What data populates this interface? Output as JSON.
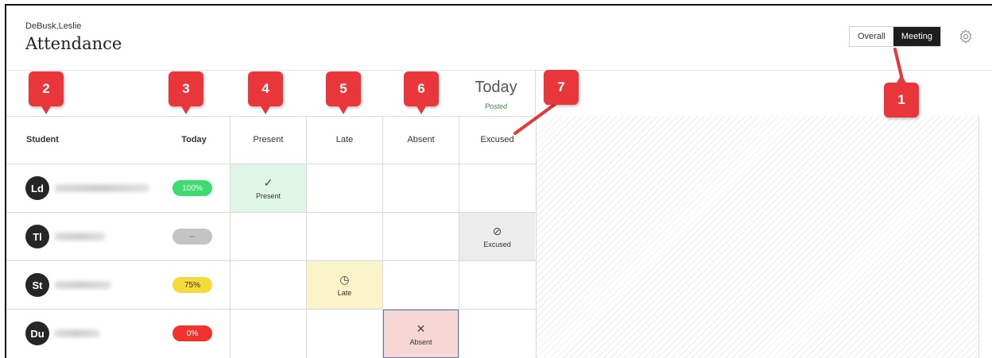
{
  "header": {
    "course_name": "DeBusk,Leslie",
    "title": "Attendance",
    "view_toggle": {
      "overall_label": "Overall",
      "meeting_label": "Meeting",
      "selected": "Meeting"
    },
    "settings_icon": "gear-icon"
  },
  "meeting": {
    "today_label": "Today",
    "status": "Posted"
  },
  "columns": {
    "student": "Student",
    "today": "Today",
    "present": "Present",
    "late": "Late",
    "absent": "Absent",
    "excused": "Excused"
  },
  "rows": [
    {
      "initials": "Ld",
      "today_pct": "100%",
      "status": "Present",
      "status_label": "Present",
      "status_icon": "check-icon"
    },
    {
      "initials": "Tl",
      "today_pct": "--",
      "status": "Excused",
      "status_label": "Excused",
      "status_icon": "circle-slash-icon"
    },
    {
      "initials": "St",
      "today_pct": "75%",
      "status": "Late",
      "status_label": "Late",
      "status_icon": "clock-icon"
    },
    {
      "initials": "Du",
      "today_pct": "0%",
      "status": "Absent",
      "status_label": "Absent",
      "status_icon": "x-icon"
    }
  ],
  "callouts": [
    "1",
    "2",
    "3",
    "4",
    "5",
    "6",
    "7"
  ],
  "colors": {
    "pill_100": "#3ddc6e",
    "pill_none": "#c4c4c4",
    "pill_75": "#f5dc3a",
    "pill_0": "#f2322f",
    "present_bg": "#dff5e6",
    "late_bg": "#fbf3c8",
    "absent_bg": "#f7d6d6",
    "excused_bg": "#ececec",
    "callout": "#e8363a"
  }
}
